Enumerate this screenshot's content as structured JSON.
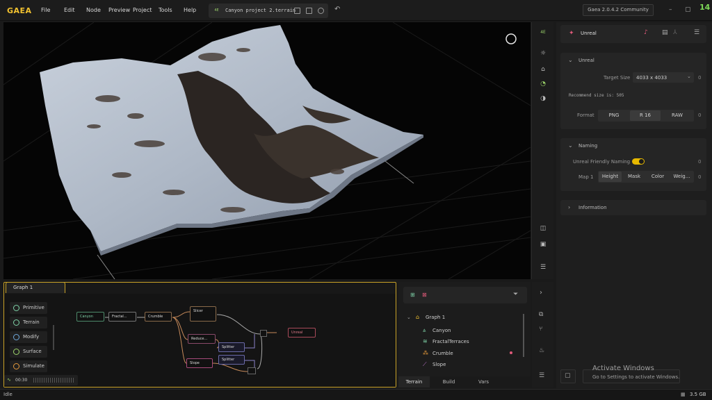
{
  "app": {
    "logo": "GAEA",
    "menu": [
      "File",
      "Edit",
      "Node",
      "Preview",
      "Project",
      "Tools",
      "Help"
    ],
    "file_badge": "4E",
    "file_name": "Canyon project 2.terrain",
    "version": "Gaea 2.0.4.2 Community",
    "fps": "14"
  },
  "right_panel": {
    "header_title": "Unreal",
    "unreal_section": {
      "title": "Unreal",
      "target_size_label": "Target Size",
      "target_size_value": "4033 x 4033",
      "target_size_zero": "0",
      "recommend_text": "Recommend size is: 505",
      "format_label": "Format",
      "format_options": [
        "PNG",
        "R 16",
        "RAW"
      ],
      "format_selected": "R 16",
      "format_zero": "0"
    },
    "naming_section": {
      "title": "Naming",
      "friendly_label": "Unreal Friendly Naming",
      "friendly_on": true,
      "friendly_zero": "0",
      "map_label": "Map 1",
      "map_options": [
        "Height",
        "Mask",
        "Color",
        "Weig..."
      ],
      "map_selected": "Height",
      "map_zero": "0"
    },
    "information_section": {
      "title": "Information"
    }
  },
  "graph": {
    "tab_label": "Graph 1",
    "categories": [
      "Primitive",
      "Terrain",
      "Modify",
      "Surface",
      "Simulate"
    ],
    "nodes": {
      "canyon": "Canyon",
      "fractal": "Fractal...",
      "crumble": "Crumble",
      "slicer": "Slicer",
      "reduce": "Reduce...",
      "slope": "Slope",
      "splitter1": "Splitter",
      "splitter2": "Splitter",
      "unreal": "Unreal"
    },
    "timer": "00:30"
  },
  "tree": {
    "root": "Graph 1",
    "items": [
      "Canyon",
      "FractalTerraces",
      "Crumble",
      "Slope"
    ],
    "tabs": [
      "Terrain",
      "Build",
      "Vars"
    ],
    "active_tab": "Terrain"
  },
  "status": {
    "text": "Idle",
    "memory": "3.5 GB"
  },
  "watermark": {
    "line1": "Activate Windows",
    "line2": "Go to Settings to activate Windows."
  },
  "colors": {
    "accent": "#f2c230",
    "fps": "#7ed957",
    "toggle": "#e6b800",
    "selected_seg": "#3b3b3b"
  }
}
